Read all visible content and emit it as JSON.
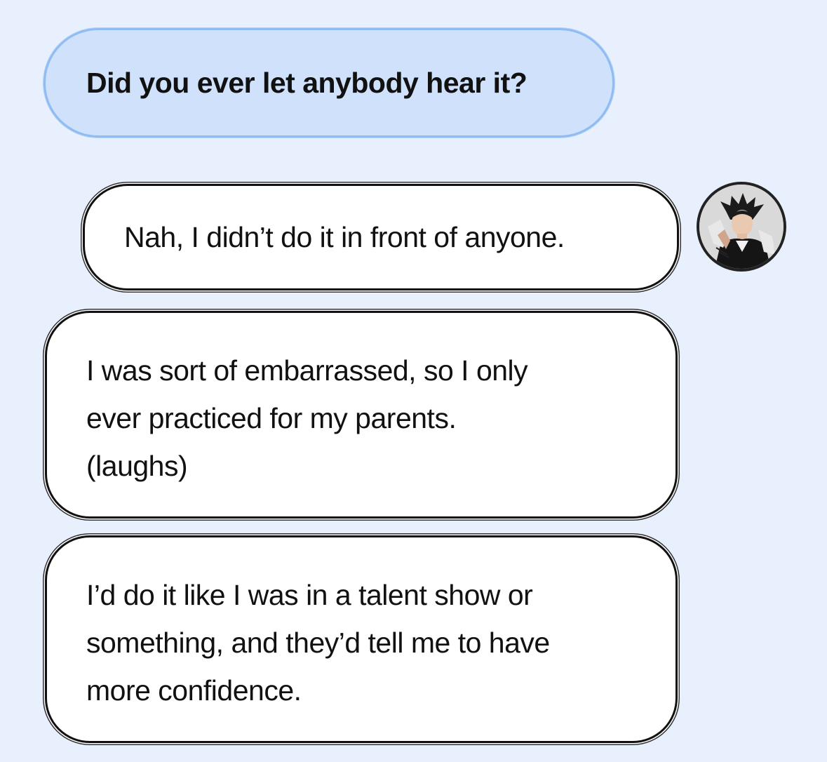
{
  "conversation": {
    "question": "Did you ever let anybody hear it?",
    "replies": [
      {
        "lines": [
          "Nah, I didn’t do it in front of anyone."
        ]
      },
      {
        "lines": [
          "I was sort of embarrassed, so I only",
          "ever practiced for my parents.",
          "(laughs)"
        ]
      },
      {
        "lines": [
          "I’d do it like I was in a talent show or",
          "something, and they’d tell me to have",
          "more confidence."
        ]
      }
    ]
  },
  "colors": {
    "background": "#e8f0fd",
    "question_bubble": "#cfe1fb",
    "question_border": "#8fbcf2",
    "answer_bubble": "#ffffff",
    "answer_border": "#111111"
  }
}
